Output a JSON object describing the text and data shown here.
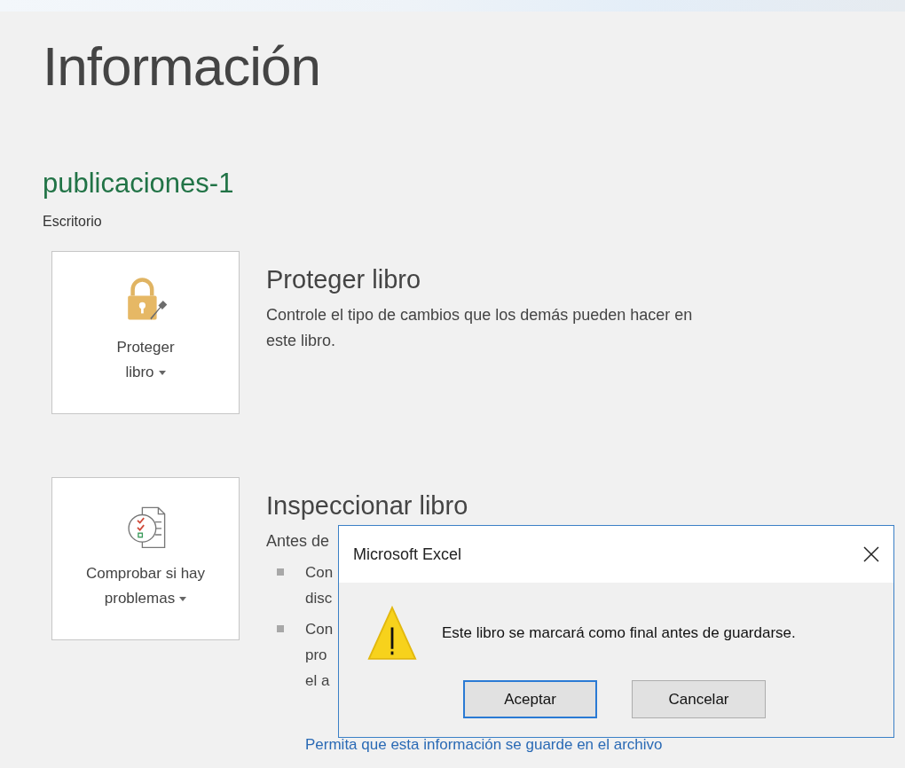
{
  "page": {
    "title": "Información"
  },
  "document": {
    "name": "publicaciones-1",
    "location": "Escritorio"
  },
  "sections": [
    {
      "kind": "lock",
      "button_lines": [
        "Proteger",
        "libro"
      ],
      "heading": "Proteger libro",
      "description": "Controle el tipo de cambios que los demás pueden hacer en este libro."
    },
    {
      "kind": "checklist",
      "button_lines": [
        "Comprobar si hay",
        "problemas"
      ],
      "heading": "Inspeccionar libro",
      "description": "Antes de",
      "bullets": [
        "Con\ndisc",
        "Con\npro\nel a"
      ],
      "link": "Permita que esta información se guarde en el archivo"
    }
  ],
  "dialog": {
    "title": "Microsoft Excel",
    "message": "Este libro se marcará como final antes de guardarse.",
    "buttons": [
      {
        "label": "Aceptar",
        "selected": true
      },
      {
        "label": "Cancelar",
        "selected": false
      }
    ]
  }
}
